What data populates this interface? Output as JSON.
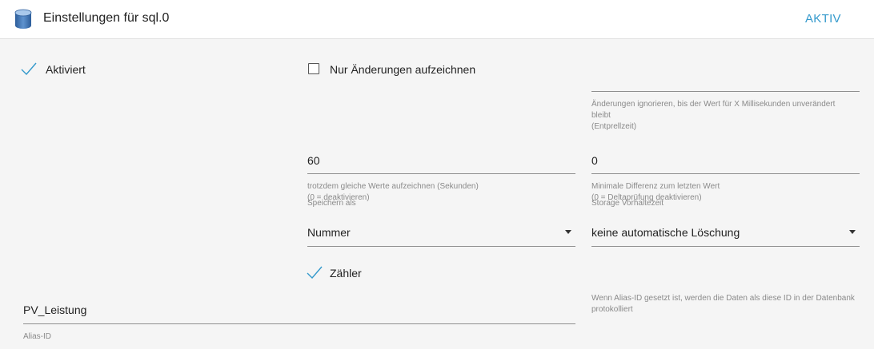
{
  "header": {
    "title": "Einstellungen für sql.0",
    "status": "AKTIV",
    "icon": "database-icon"
  },
  "settings": {
    "enabled": {
      "label": "Aktiviert",
      "checked": true
    },
    "changes_only": {
      "label": "Nur Änderungen aufzeichnen",
      "checked": false
    },
    "debounce": {
      "value": "",
      "helper_line1": "Änderungen ignorieren, bis der Wert für X Millisekunden unverändert",
      "helper_line2": "bleibt",
      "helper_line3": "(Entprellzeit)"
    },
    "same_values": {
      "value": "60",
      "helper_line1": "trotzdem gleiche Werte aufzeichnen (Sekunden)",
      "helper_line2": "(0 = deaktivieren)"
    },
    "min_diff": {
      "value": "0",
      "helper_line1": "Minimale Differenz zum letzten Wert",
      "helper_line2": "(0 = Deltaprüfung deaktivieren)"
    },
    "store_as": {
      "label": "Speichern als",
      "value": "Nummer"
    },
    "retention": {
      "label": "Storage Vorhaltezeit",
      "value": "keine automatische Löschung"
    },
    "counter": {
      "label": "Zähler",
      "checked": true
    },
    "alias": {
      "value": "PV_Leistung",
      "label": "Alias-ID",
      "helper_line1": "Wenn Alias-ID gesetzt ist, werden die Daten als diese ID in der Datenbank",
      "helper_line2": "protokolliert"
    }
  },
  "colors": {
    "accent": "#3399cc",
    "panel_bg": "#f5f5f5"
  }
}
